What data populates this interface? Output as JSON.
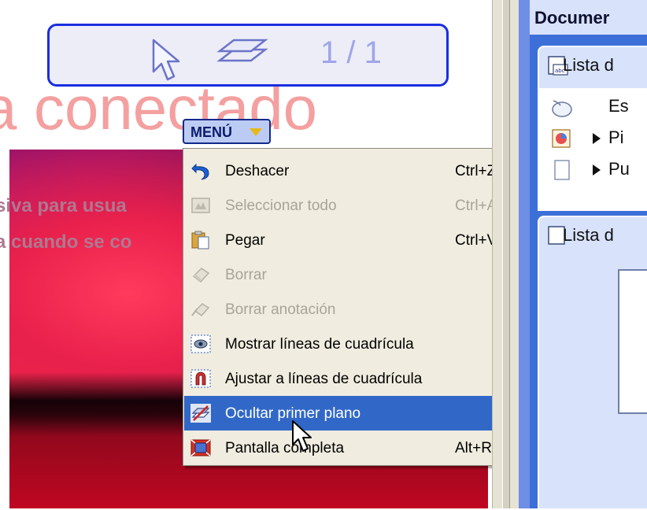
{
  "slide": {
    "title_fragment": "a conectado",
    "overlay_line_1": "siva para usua",
    "overlay_line_2": "a cuando se co"
  },
  "toolbar": {
    "page_counter": "1 / 1",
    "pointer_icon": "pointer-arrow-icon",
    "layers_icon": "layers-icon"
  },
  "menu_button": {
    "label": "MENÚ"
  },
  "context_menu": {
    "items": [
      {
        "label": "Deshacer",
        "shortcut": "Ctrl+Z",
        "enabled": true,
        "icon": "undo-icon"
      },
      {
        "label": "Seleccionar todo",
        "shortcut": "Ctrl+A",
        "enabled": false,
        "icon": "select-all-icon"
      },
      {
        "label": "Pegar",
        "shortcut": "Ctrl+V",
        "enabled": true,
        "icon": "paste-icon"
      },
      {
        "label": "Borrar",
        "shortcut": "",
        "enabled": false,
        "icon": "eraser-icon"
      },
      {
        "label": "Borrar anotación",
        "shortcut": "",
        "enabled": false,
        "icon": "erase-annotation-icon"
      },
      {
        "label": "Mostrar líneas de cuadrícula",
        "shortcut": "",
        "enabled": true,
        "icon": "show-grid-icon"
      },
      {
        "label": "Ajustar a líneas de cuadrícula",
        "shortcut": "",
        "enabled": true,
        "icon": "snap-grid-icon"
      },
      {
        "label": "Ocultar primer plano",
        "shortcut": "",
        "enabled": true,
        "highlighted": true,
        "icon": "hide-foreground-icon"
      },
      {
        "label": "Pantalla completa",
        "shortcut": "Alt+Retorno",
        "enabled": true,
        "icon": "fullscreen-icon"
      }
    ]
  },
  "right_panel": {
    "header": "Documer",
    "group_1": {
      "title": "Lista d",
      "rows": [
        {
          "text": "Es",
          "icon": "mouse-icon",
          "arrow": false
        },
        {
          "text": "Pi",
          "icon": "chart-icon",
          "arrow": true
        },
        {
          "text": "Pu",
          "icon": "document-icon",
          "arrow": true
        }
      ]
    },
    "group_2": {
      "title": "Lista d"
    }
  },
  "colors": {
    "menu_highlight": "#3168c8",
    "menu_background": "#f0ecdf",
    "toolbar_border": "#1a2ee0",
    "panel_blue": "#3d6fd8",
    "title_pink": "#f4a0a0"
  }
}
